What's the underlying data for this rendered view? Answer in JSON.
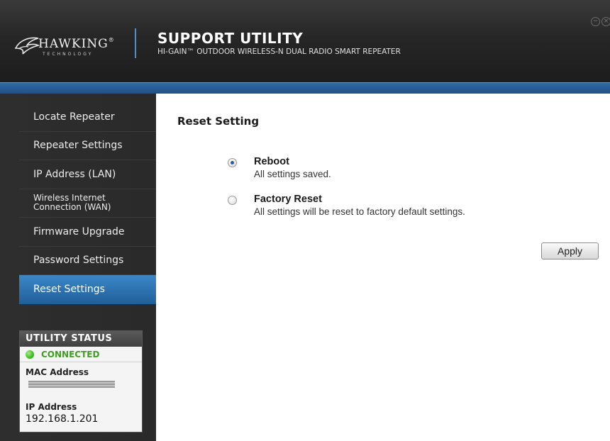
{
  "header": {
    "logo": {
      "word": "HAWKING",
      "registered": "®",
      "sub": "TECHNOLOGY"
    },
    "title": "SUPPORT UTILITY",
    "subtitle": "HI-GAIN™ OUTDOOR WIRELESS-N DUAL RADIO SMART REPEATER",
    "window_controls": {
      "minimize_icon": "minimize-icon",
      "close_icon": "close-icon"
    }
  },
  "sidebar": {
    "items": [
      {
        "label": "Locate Repeater",
        "active": false
      },
      {
        "label": "Repeater Settings",
        "active": false
      },
      {
        "label": "IP Address (LAN)",
        "active": false
      },
      {
        "label": "Wireless Internet Connection (WAN)",
        "active": false
      },
      {
        "label": "Firmware Upgrade",
        "active": false
      },
      {
        "label": "Password Settings",
        "active": false
      },
      {
        "label": "Reset Settings",
        "active": true
      }
    ],
    "status": {
      "title": "UTILITY STATUS",
      "connection": "CONNECTED",
      "mac_label": "MAC Address",
      "ip_label": "IP Address",
      "ip_value": "192.168.1.201"
    }
  },
  "main": {
    "title": "Reset Setting",
    "options": [
      {
        "label": "Reboot",
        "description": "All settings saved.",
        "checked": true
      },
      {
        "label": "Factory Reset",
        "description": "All settings will be reset to factory default settings.",
        "checked": false
      }
    ],
    "apply_label": "Apply"
  },
  "colors": {
    "accent_blue": "#2a6ca9",
    "header_bg": "#262626",
    "sidebar_bg": "#2c2c2c",
    "connected_green": "#3e9f1c"
  }
}
